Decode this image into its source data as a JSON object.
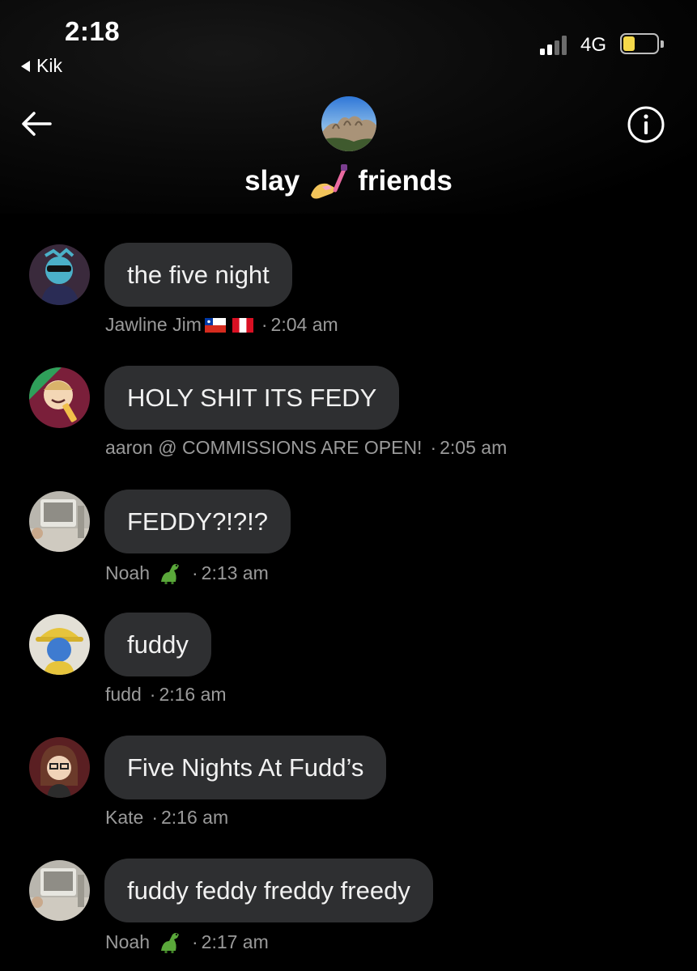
{
  "status_bar": {
    "time": "2:18",
    "back_app": "Kik",
    "network": "4G",
    "signal_bars": 2,
    "battery_level": 0.35
  },
  "header": {
    "title_part1": "slay",
    "title_part2": "friends",
    "title_emoji": "nail-polish-emoji"
  },
  "messages": [
    {
      "text": "the five night",
      "sender": "Jawline Jim",
      "sender_extra": "flags-chile-peru",
      "time": "2:04 am"
    },
    {
      "text": "HOLY SHIT ITS FEDY",
      "sender": "aaron @ COMMISSIONS ARE OPEN!",
      "time": "2:05 am"
    },
    {
      "text": "FEDDY?!?!?",
      "sender": "Noah",
      "sender_extra": "dinosaur-emoji",
      "time": "2:13 am"
    },
    {
      "text": "fuddy",
      "sender": "fudd",
      "time": "2:16 am"
    },
    {
      "text": "Five Nights At Fudd’s",
      "sender": "Kate",
      "time": "2:16 am"
    },
    {
      "text": "fuddy feddy freddy freedy",
      "sender": "Noah",
      "sender_extra": "dinosaur-emoji",
      "time": "2:17 am"
    }
  ],
  "meta_separator": "·",
  "colors": {
    "background": "#000000",
    "bubble": "#2e2f31",
    "meta_text": "#9a9a9a",
    "battery": "#f5d94a"
  }
}
